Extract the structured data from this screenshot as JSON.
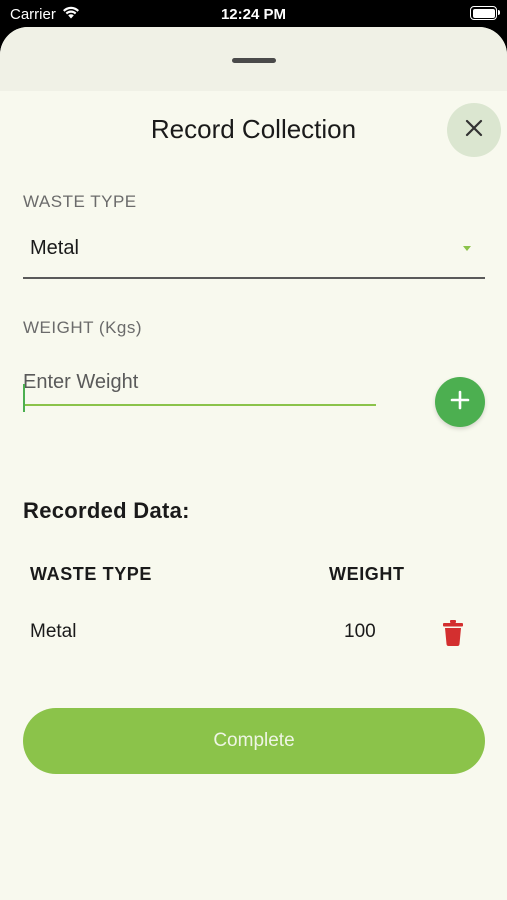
{
  "status_bar": {
    "carrier": "Carrier",
    "time": "12:24 PM"
  },
  "sheet": {
    "title": "Record Collection",
    "close_icon": "close-icon"
  },
  "form": {
    "waste_type_label": "WASTE TYPE",
    "waste_type_value": "Metal",
    "weight_label": "WEIGHT (Kgs)",
    "weight_placeholder": "Enter Weight",
    "weight_value": ""
  },
  "recorded": {
    "title": "Recorded Data:",
    "columns": [
      "WASTE TYPE",
      "WEIGHT"
    ],
    "rows": [
      {
        "waste_type": "Metal",
        "weight": "100"
      }
    ]
  },
  "actions": {
    "complete_label": "Complete"
  },
  "colors": {
    "background": "#f8f9ee",
    "primary_green": "#4caf50",
    "light_green": "#8bc34a",
    "delete_red": "#d32f2f",
    "close_bg": "#dbe6d0"
  }
}
